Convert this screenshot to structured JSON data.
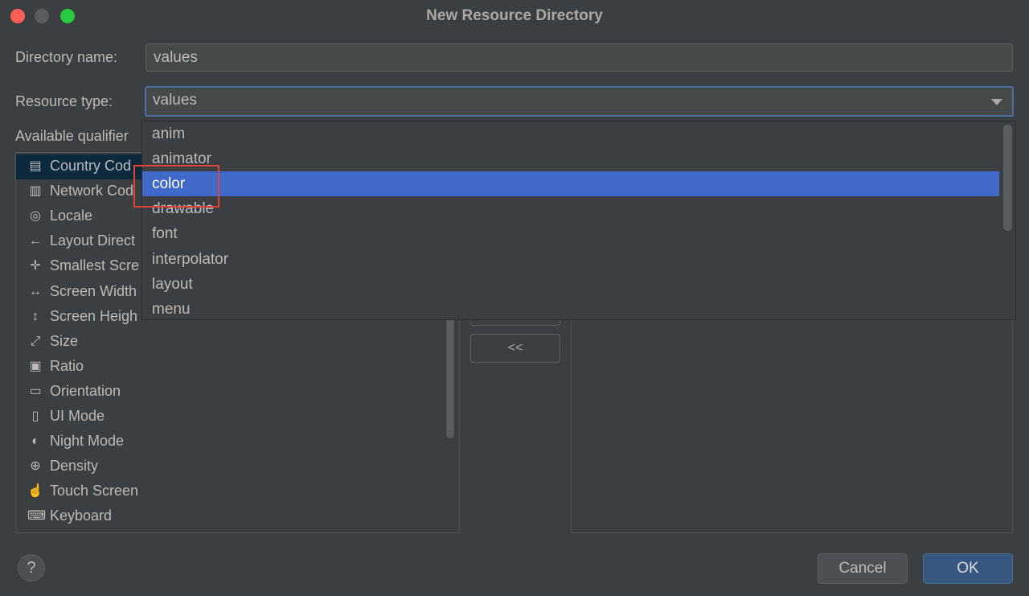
{
  "window": {
    "title": "New Resource Directory"
  },
  "form": {
    "directory_name_label": "Directory name:",
    "directory_name_value": "values",
    "resource_type_label": "Resource type:",
    "resource_type_value": "values",
    "available_qualifiers_label": "Available qualifier"
  },
  "qualifiers": [
    {
      "label": "Country Cod",
      "icon": "country-code-icon",
      "selected": true
    },
    {
      "label": "Network Cod",
      "icon": "network-code-icon"
    },
    {
      "label": "Locale",
      "icon": "globe-icon"
    },
    {
      "label": "Layout Direct",
      "icon": "layout-direction-icon"
    },
    {
      "label": "Smallest Scre",
      "icon": "smallest-screen-icon"
    },
    {
      "label": "Screen Width",
      "icon": "screen-width-icon"
    },
    {
      "label": "Screen Heigh",
      "icon": "screen-height-icon"
    },
    {
      "label": "Size",
      "icon": "size-icon"
    },
    {
      "label": "Ratio",
      "icon": "ratio-icon"
    },
    {
      "label": "Orientation",
      "icon": "orientation-icon"
    },
    {
      "label": "UI Mode",
      "icon": "ui-mode-icon"
    },
    {
      "label": "Night Mode",
      "icon": "night-mode-icon"
    },
    {
      "label": "Density",
      "icon": "density-icon"
    },
    {
      "label": "Touch Screen",
      "icon": "touch-screen-icon"
    },
    {
      "label": "Keyboard",
      "icon": "keyboard-icon"
    }
  ],
  "transfer": {
    "remove_label": "<<"
  },
  "dropdown": {
    "options": [
      "anim",
      "animator",
      "color",
      "drawable",
      "font",
      "interpolator",
      "layout",
      "menu"
    ],
    "highlighted": "color"
  },
  "buttons": {
    "help_label": "?",
    "cancel_label": "Cancel",
    "ok_label": "OK"
  },
  "colors": {
    "background": "#3c3f41",
    "highlight_selection": "#4169c9",
    "annotation_box": "#e54335",
    "ok_button": "#365880"
  }
}
